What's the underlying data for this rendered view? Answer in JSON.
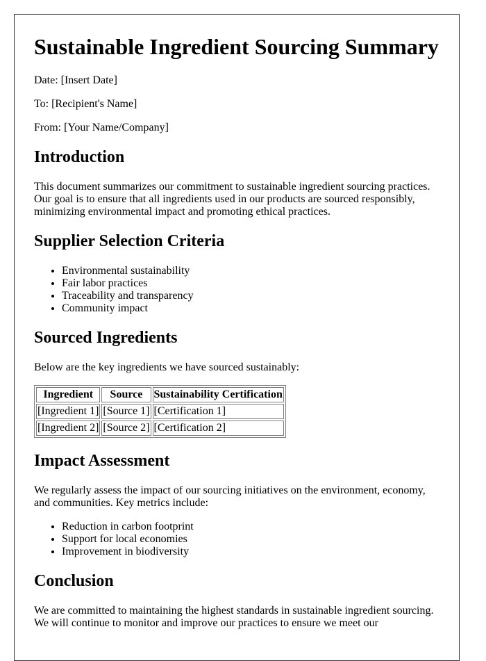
{
  "document": {
    "title": "Sustainable Ingredient Sourcing Summary",
    "meta": {
      "date": "Date: [Insert Date]",
      "to": "To: [Recipient's Name]",
      "from": "From: [Your Name/Company]"
    },
    "sections": {
      "introduction": {
        "heading": "Introduction",
        "body": "This document summarizes our commitment to sustainable ingredient sourcing practices. Our goal is to ensure that all ingredients used in our products are sourced responsibly, minimizing environmental impact and promoting ethical practices."
      },
      "supplier_criteria": {
        "heading": "Supplier Selection Criteria",
        "items": [
          "Environmental sustainability",
          "Fair labor practices",
          "Traceability and transparency",
          "Community impact"
        ]
      },
      "sourced_ingredients": {
        "heading": "Sourced Ingredients",
        "intro": "Below are the key ingredients we have sourced sustainably:",
        "table": {
          "headers": [
            "Ingredient",
            "Source",
            "Sustainability Certification"
          ],
          "rows": [
            [
              "[Ingredient 1]",
              "[Source 1]",
              "[Certification 1]"
            ],
            [
              "[Ingredient 2]",
              "[Source 2]",
              "[Certification 2]"
            ]
          ]
        }
      },
      "impact_assessment": {
        "heading": "Impact Assessment",
        "body": "We regularly assess the impact of our sourcing initiatives on the environment, economy, and communities. Key metrics include:",
        "items": [
          "Reduction in carbon footprint",
          "Support for local economies",
          "Improvement in biodiversity"
        ]
      },
      "conclusion": {
        "heading": "Conclusion",
        "body": "We are committed to maintaining the highest standards in sustainable ingredient sourcing. We will continue to monitor and improve our practices to ensure we meet our"
      }
    }
  }
}
